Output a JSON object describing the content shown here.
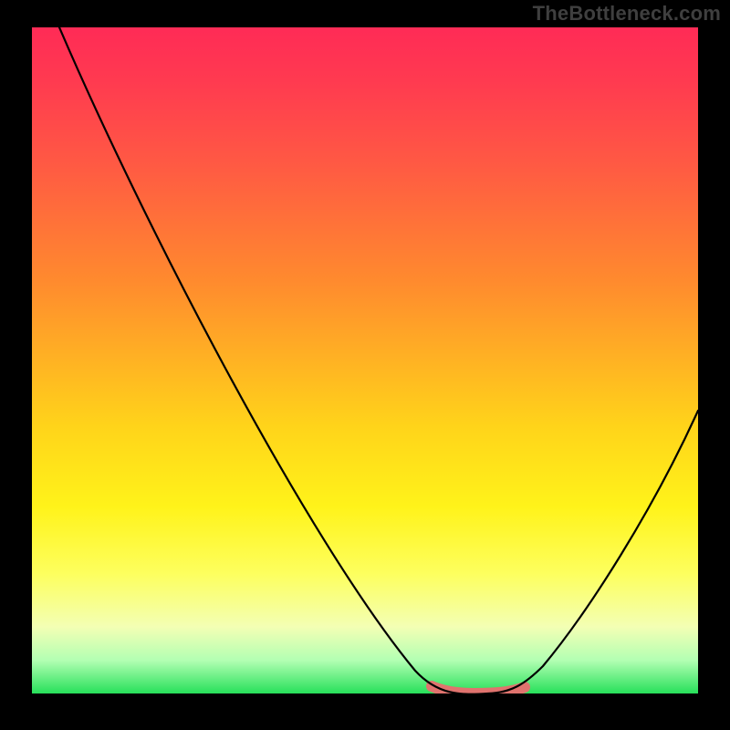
{
  "watermark": "TheBottleneck.com",
  "chart_data": {
    "type": "line",
    "title": "",
    "xlabel": "",
    "ylabel": "",
    "xlim": [
      0,
      100
    ],
    "ylim": [
      0,
      100
    ],
    "grid": false,
    "series": [
      {
        "name": "curve",
        "points": [
          {
            "x": 4,
            "y": 100
          },
          {
            "x": 60,
            "y": 2
          },
          {
            "x": 66,
            "y": 0
          },
          {
            "x": 74,
            "y": 0
          },
          {
            "x": 100,
            "y": 42
          }
        ]
      }
    ],
    "highlight_range": {
      "x_start": 60,
      "x_end": 74
    },
    "background": "red-yellow-green vertical gradient"
  },
  "colors": {
    "highlight": "#e0736e",
    "curve": "#000000"
  }
}
